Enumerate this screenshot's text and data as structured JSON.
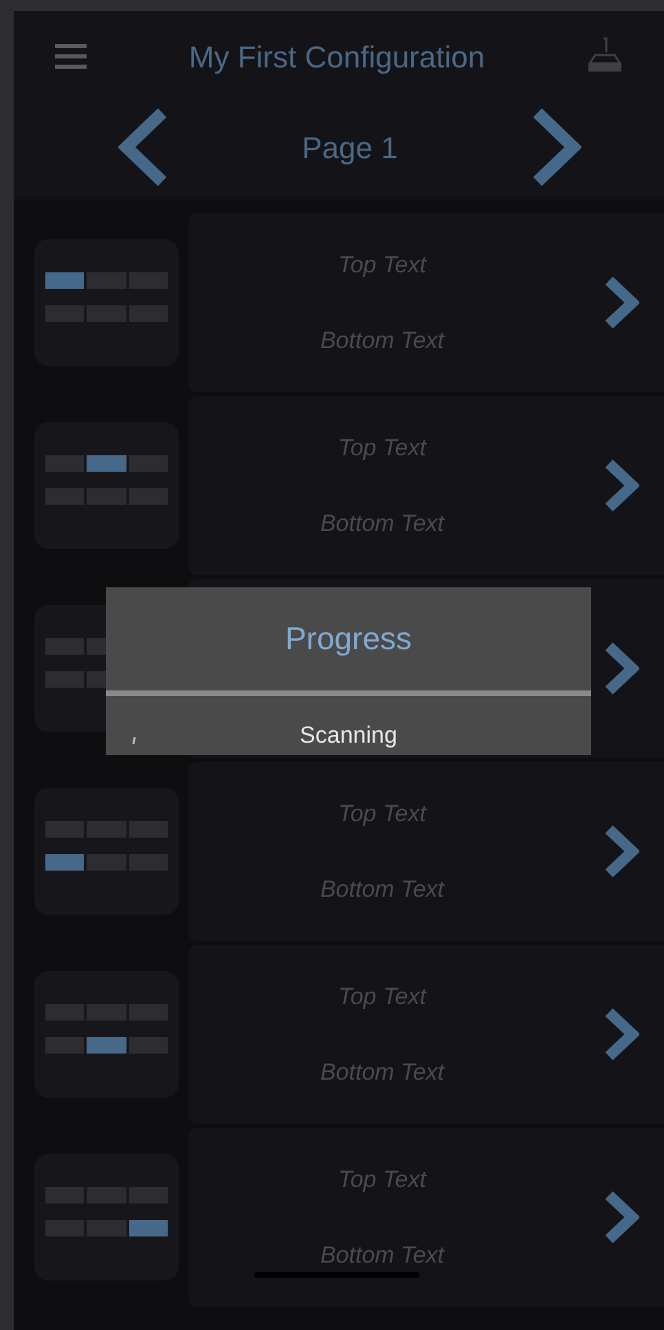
{
  "header": {
    "title": "My First Configuration"
  },
  "pager": {
    "label": "Page 1"
  },
  "rows": [
    {
      "top_text": "Top Text",
      "bottom_text": "Bottom Text",
      "cells": [
        {
          "selected": true
        },
        {
          "selected": false
        },
        {
          "selected": false
        },
        {
          "selected": false
        },
        {
          "selected": false
        },
        {
          "selected": false
        }
      ]
    },
    {
      "top_text": "Top Text",
      "bottom_text": "Bottom Text",
      "cells": [
        {
          "selected": false
        },
        {
          "selected": true
        },
        {
          "selected": false
        },
        {
          "selected": false
        },
        {
          "selected": false
        },
        {
          "selected": false
        }
      ]
    },
    {
      "cells": [
        {
          "selected": false
        },
        {
          "selected": false
        },
        null,
        {
          "selected": false
        },
        {
          "selected": false
        },
        null
      ]
    },
    {
      "top_text": "Top Text",
      "bottom_text": "Bottom Text",
      "cells": [
        {
          "selected": false
        },
        {
          "selected": false
        },
        {
          "selected": false
        },
        {
          "selected": true
        },
        {
          "selected": false
        },
        {
          "selected": false
        }
      ]
    },
    {
      "top_text": "Top Text",
      "bottom_text": "Bottom Text",
      "cells": [
        {
          "selected": false
        },
        {
          "selected": false
        },
        {
          "selected": false
        },
        {
          "selected": false
        },
        {
          "selected": true
        },
        {
          "selected": false
        }
      ]
    },
    {
      "top_text": "Top Text",
      "bottom_text": "Bottom Text",
      "cells": [
        {
          "selected": false
        },
        {
          "selected": false
        },
        {
          "selected": false
        },
        {
          "selected": false
        },
        {
          "selected": false
        },
        {
          "selected": true
        }
      ]
    }
  ],
  "dialog": {
    "title": "Progress",
    "message": "Scanning"
  }
}
